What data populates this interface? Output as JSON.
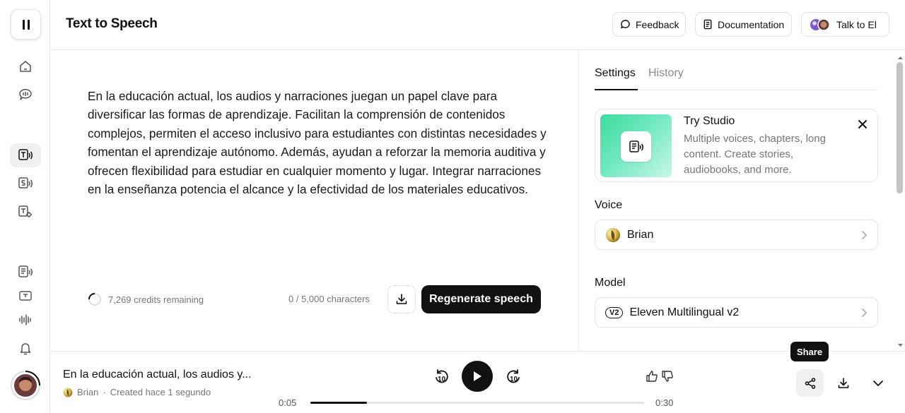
{
  "header": {
    "title": "Text to Speech",
    "feedback_label": "Feedback",
    "documentation_label": "Documentation",
    "talk_label": "Talk to El"
  },
  "editor": {
    "text": "En la educación actual, los audios y narraciones juegan un papel clave para diversificar las formas de aprendizaje. Facilitan la comprensión de contenidos complejos, permiten el acceso inclusivo para estudiantes con distintas necesidades y fomentan el aprendizaje autónomo. Además, ayudan a reforzar la memoria auditiva y ofrecen flexibilidad para estudiar en cualquier momento y lugar. Integrar narraciones en la enseñanza potencia el alcance y la efectividad de los materiales educativos.",
    "credits": "7,269 credits remaining",
    "char_count": "0 / 5,000 characters",
    "regenerate_label": "Regenerate speech"
  },
  "panel": {
    "tabs": [
      {
        "label": "Settings",
        "active": true
      },
      {
        "label": "History",
        "active": false
      }
    ],
    "studio": {
      "title": "Try Studio",
      "description": "Multiple voices, chapters, long content. Create stories, audiobooks, and more."
    },
    "voice_label": "Voice",
    "voice_value": "Brian",
    "model_label": "Model",
    "model_badge": "V2",
    "model_value": "Eleven Multilingual v2"
  },
  "player": {
    "title": "En la educación actual, los audios y...",
    "voice": "Brian",
    "separator": "·",
    "created": "Created hace 1 segundo",
    "rewind_label": "10",
    "forward_label": "10",
    "time_current": "0:05",
    "time_total": "0:30",
    "progress_fraction": 0.17,
    "tooltip": "Share"
  },
  "icons": {
    "rail": [
      "pause-icon",
      "home-icon",
      "voice-chat-icon",
      "text-to-speech-icon",
      "speech-to-speech-icon",
      "sound-effects-icon",
      "studio-icon",
      "translate-icon",
      "waveform-icon",
      "bell-icon"
    ],
    "player": [
      "rewind-10-icon",
      "play-icon",
      "forward-10-icon",
      "thumbs-up-icon",
      "thumbs-down-icon",
      "share-icon",
      "download-icon",
      "chevron-down-icon"
    ]
  },
  "colors": {
    "accent": "#111111",
    "border": "#ebebeb",
    "muted_text": "#777777",
    "studio_gradient_start": "#3ddc9b",
    "studio_gradient_end": "#c7f7ea"
  }
}
